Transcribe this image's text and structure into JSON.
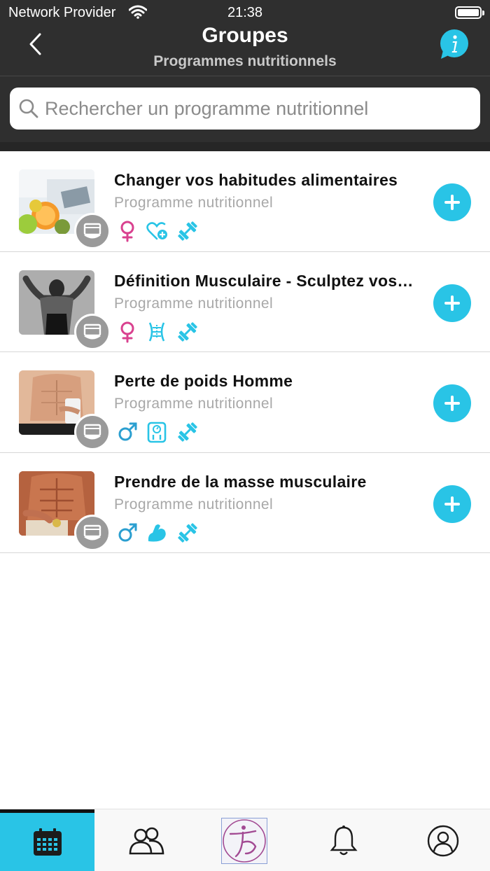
{
  "status_bar": {
    "carrier": "Network Provider",
    "time": "21:38"
  },
  "header": {
    "title": "Groupes",
    "subtitle": "Programmes nutritionnels"
  },
  "search": {
    "placeholder": "Rechercher un programme nutritionnel"
  },
  "programs": [
    {
      "title": "Changer vos habitudes alimentaires",
      "subtitle": "Programme nutritionnel",
      "tags": [
        "female-icon",
        "heart-plus-icon",
        "dumbbell-icon"
      ]
    },
    {
      "title": "Définition Musculaire - Sculptez vos courbes",
      "subtitle": "Programme nutritionnel",
      "tags": [
        "female-icon",
        "waist-icon",
        "dumbbell-icon"
      ]
    },
    {
      "title": "Perte de poids Homme",
      "subtitle": "Programme nutritionnel",
      "tags": [
        "male-icon",
        "scale-icon",
        "dumbbell-icon"
      ]
    },
    {
      "title": "Prendre de la masse musculaire",
      "subtitle": "Programme nutritionnel",
      "tags": [
        "male-icon",
        "biceps-icon",
        "dumbbell-icon"
      ]
    }
  ],
  "tabbar": {
    "tabs": [
      "calendar-icon",
      "group-icon",
      "app-logo",
      "bell-icon",
      "profile-icon"
    ],
    "active": "calendar-icon"
  },
  "colors": {
    "accent": "#29c4e6",
    "female": "#d9418f",
    "header_bg": "#2f2f2f",
    "badge_bg": "#9a9a9a"
  }
}
